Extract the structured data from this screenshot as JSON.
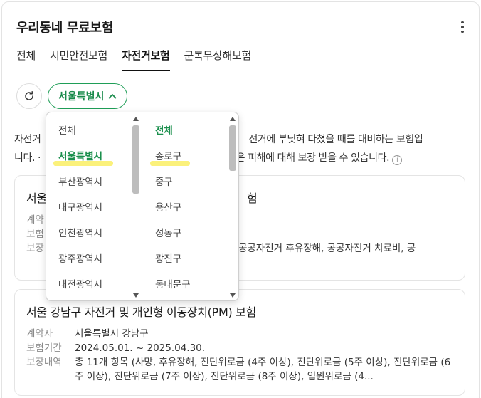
{
  "header": {
    "title": "우리동네 무료보험"
  },
  "tabs": [
    {
      "label": "전체"
    },
    {
      "label": "시민안전보험"
    },
    {
      "label": "자전거보험",
      "active": true
    },
    {
      "label": "군복무상해보험"
    }
  ],
  "filter": {
    "selected_region": "서울특별시"
  },
  "description": {
    "part1": "자전거",
    "part2": "전거에 부딪혀 다쳤을 때를 대비하는 보험입",
    "line2_a": "니다. ·",
    "line2_b": "같은 피해에 대해 보장 받을 수 있습니다.",
    "info_glyph": "i"
  },
  "cards": [
    {
      "title_start": "서울",
      "title_end": "험",
      "labels": {
        "contractor": "계약",
        "period": "보험",
        "coverage": "보장"
      },
      "coverage_tail": "공공자전거 후유장해, 공공자전거 치료비, 공"
    },
    {
      "title": "서울 강남구 자전거 및 개인형 이동장치(PM) 보험",
      "contractor_label": "계약자",
      "contractor": "서울특별시 강남구",
      "period_label": "보험기간",
      "period": "2024.05.01. ~ 2025.04.30.",
      "coverage_label": "보장내역",
      "coverage": "총 11개 항목 (사망, 후유장해, 진단위로금 (4주 이상), 진단위로금 (5주 이상), 진단위로금 (6주 이상), 진단위로금 (7주 이상), 진단위로금 (8주 이상), 입원위로금 (4..."
    }
  ],
  "dropdown": {
    "provinces": [
      "전체",
      "서울특별시",
      "부산광역시",
      "대구광역시",
      "인천광역시",
      "광주광역시",
      "대전광역시"
    ],
    "provinces_selected": 1,
    "districts": [
      "전체",
      "종로구",
      "중구",
      "용산구",
      "성동구",
      "광진구",
      "동대문구"
    ],
    "districts_selected": 0
  },
  "colors": {
    "accent": "#1f9e57",
    "highlight": "#fbf17b"
  }
}
